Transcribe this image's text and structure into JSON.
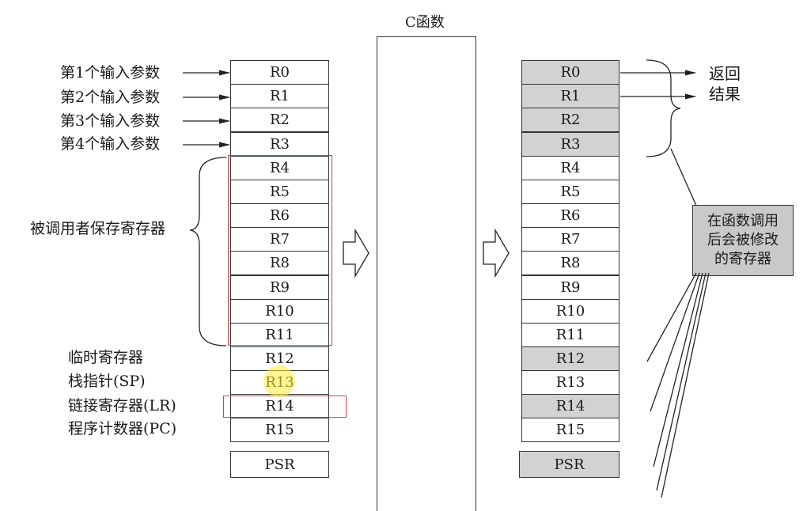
{
  "c_function_label": "C函数",
  "input_labels": [
    "第1个输入参数",
    "第2个输入参数",
    "第3个输入参数",
    "第4个输入参数"
  ],
  "callee_saved_label": "被调用者保存寄存器",
  "special_labels": {
    "temp": "临时寄存器",
    "sp": "栈指针(SP)",
    "lr": "链接寄存器(LR)",
    "pc": "程序计数器(PC)"
  },
  "left_registers": [
    "R0",
    "R1",
    "R2",
    "R3",
    "R4",
    "R5",
    "R6",
    "R7",
    "R8",
    "R9",
    "R10",
    "R11",
    "R12",
    "R13",
    "R14",
    "R15"
  ],
  "right_registers": [
    {
      "name": "R0",
      "shaded": true
    },
    {
      "name": "R1",
      "shaded": true
    },
    {
      "name": "R2",
      "shaded": true
    },
    {
      "name": "R3",
      "shaded": true
    },
    {
      "name": "R4",
      "shaded": false
    },
    {
      "name": "R5",
      "shaded": false
    },
    {
      "name": "R6",
      "shaded": false
    },
    {
      "name": "R7",
      "shaded": false
    },
    {
      "name": "R8",
      "shaded": false
    },
    {
      "name": "R9",
      "shaded": false
    },
    {
      "name": "R10",
      "shaded": false
    },
    {
      "name": "R11",
      "shaded": false
    },
    {
      "name": "R12",
      "shaded": true
    },
    {
      "name": "R13",
      "shaded": false
    },
    {
      "name": "R14",
      "shaded": true
    },
    {
      "name": "R15",
      "shaded": false
    }
  ],
  "psr_label": "PSR",
  "right_psr_shaded": true,
  "return_result_lines": [
    "返回",
    "结果"
  ],
  "modified_callout_lines": [
    "在函数调用",
    "后会被修改",
    "的寄存器"
  ],
  "colors": {
    "shade": "#d2d2d2",
    "highlight_box": "#e03c3c",
    "line": "#333333"
  }
}
